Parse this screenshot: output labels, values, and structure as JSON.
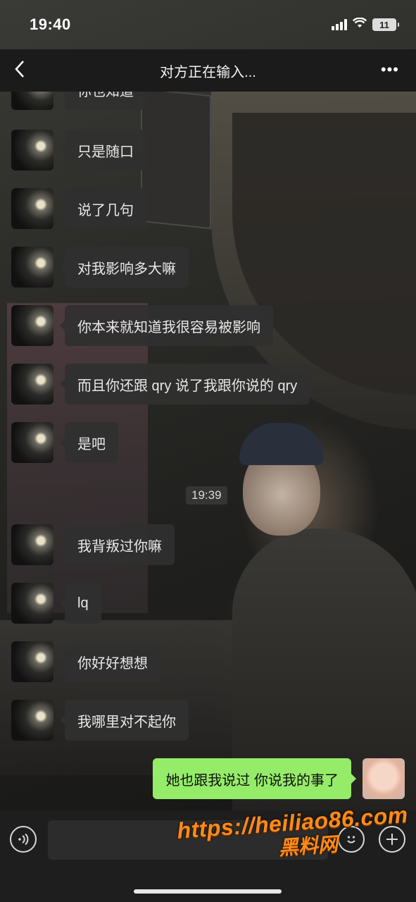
{
  "status_bar": {
    "time": "19:40",
    "battery": "11"
  },
  "nav": {
    "back_icon": "chevron-left-icon",
    "title": "对方正在输入...",
    "more_label": "•••"
  },
  "messages": [
    {
      "text": "你也知道"
    },
    {
      "text": "只是随口"
    },
    {
      "text": "说了几句"
    },
    {
      "text": "对我影响多大嘛"
    },
    {
      "text": "你本来就知道我很容易被影响"
    },
    {
      "text": "而且你还跟 qry 说了我跟你说的 qry"
    },
    {
      "text": "是吧"
    },
    {
      "text": "我背叛过你嘛"
    },
    {
      "text": "lq"
    },
    {
      "text": "你好好想想"
    },
    {
      "text": "我哪里对不起你"
    }
  ],
  "timestamp": "19:39",
  "my_message": {
    "text": "她也跟我说过 你说我的事了"
  },
  "input_bar": {
    "voice_icon": "voice-icon",
    "emoji_icon": "emoji-icon",
    "plus_icon": "plus-icon"
  },
  "watermark": {
    "url": "https://heiliao86.com",
    "name": "黑料网"
  },
  "colors": {
    "my_bubble": "#95ec69",
    "other_bubble": "#303030",
    "watermark": "#ff8a1a"
  }
}
